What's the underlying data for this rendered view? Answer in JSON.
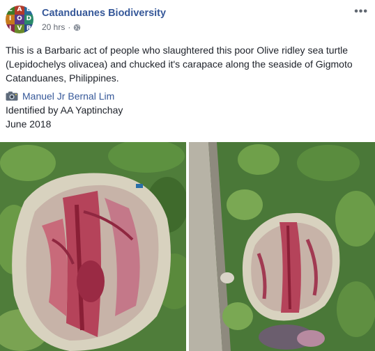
{
  "page": {
    "name": "Catanduanes Biodiversity",
    "time": "20 hrs",
    "avatar_letters": [
      "C",
      "A",
      "B",
      "I",
      "O",
      "D",
      "I",
      "V",
      "R"
    ],
    "avatar_colors": [
      "#3d7a2a",
      "#b33a2a",
      "#2a6a9a",
      "#c77a1c",
      "#5a3a8a",
      "#2a8a6a",
      "#8a2a4a",
      "#6a8a2a",
      "#2a4a8a"
    ]
  },
  "post": {
    "text": "This is a Barbaric act of people who slaughtered this poor Olive ridley sea turtle (Lepidochelys olivacea) and chucked it's carapace along the seaside of Gigmoto Catanduanes, Philippines.",
    "credit_name": "Manuel Jr Bernal Lim",
    "identified_by": "Identified by AA Yaptinchay",
    "date": "June 2018"
  },
  "icons": {
    "more": "more-options-icon",
    "privacy": "globe-icon",
    "camera": "camera-icon"
  },
  "colors": {
    "link": "#365899",
    "meta": "#616770",
    "text": "#1d2129"
  }
}
